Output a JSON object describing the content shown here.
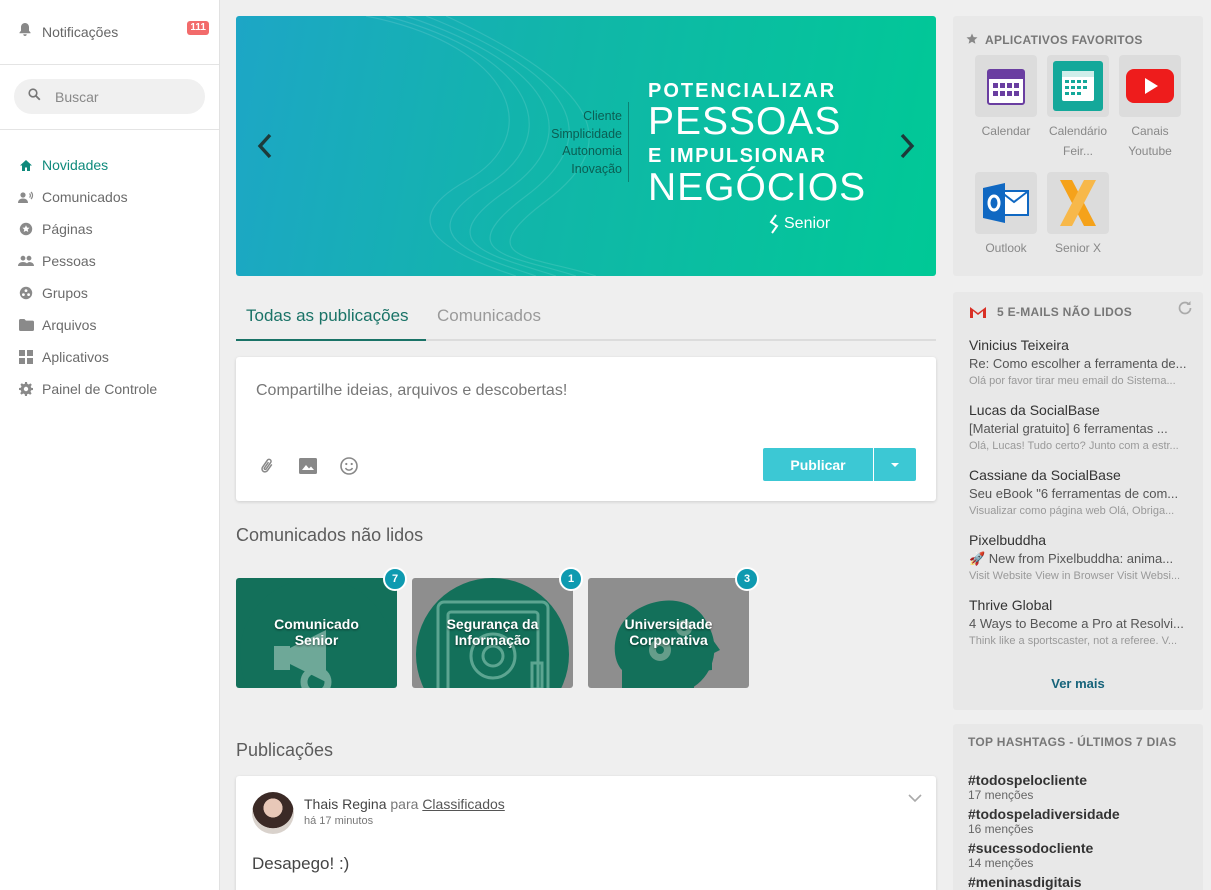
{
  "sidebar": {
    "notifications_label": "Notificações",
    "notifications_count": "111",
    "search_placeholder": "Buscar",
    "nav": [
      {
        "label": "Novidades",
        "icon": "home-icon",
        "active": true
      },
      {
        "label": "Comunicados",
        "icon": "megaphone-icon"
      },
      {
        "label": "Páginas",
        "icon": "page-star-icon"
      },
      {
        "label": "Pessoas",
        "icon": "people-icon"
      },
      {
        "label": "Grupos",
        "icon": "groups-icon"
      },
      {
        "label": "Arquivos",
        "icon": "folder-icon"
      },
      {
        "label": "Aplicativos",
        "icon": "apps-icon"
      },
      {
        "label": "Painel de Controle",
        "icon": "gear-icon"
      }
    ]
  },
  "banner": {
    "words": [
      "Cliente",
      "Simplicidade",
      "Autonomia",
      "Inovação"
    ],
    "line1": "POTENCIALIZAR",
    "line2": "PESSOAS",
    "line3": "E IMPULSIONAR",
    "line4": "NEGÓCIOS",
    "brand": "Senior",
    "accent": "#00c996"
  },
  "tabs": [
    {
      "label": "Todas as publicações",
      "active": true
    },
    {
      "label": "Comunicados",
      "active": false
    }
  ],
  "composer": {
    "placeholder": "Compartilhe ideias, arquivos e descobertas!",
    "publish_label": "Publicar"
  },
  "unread": {
    "title": "Comunicados não lidos",
    "cards": [
      {
        "title_line1": "Comunicado",
        "title_line2": "Senior",
        "count": "7",
        "color": "#13705a"
      },
      {
        "title_line1": "Segurança da",
        "title_line2": "Informação",
        "count": "1",
        "color": "#13705a"
      },
      {
        "title_line1": "Universidade",
        "title_line2": "Corporativa",
        "count": "3",
        "color": "#13705a"
      }
    ]
  },
  "posts": {
    "title": "Publicações",
    "items": [
      {
        "author": "Thais Regina",
        "connector": "para",
        "group": "Classificados",
        "time": "há 17 minutos",
        "body": "Desapego! :)"
      }
    ]
  },
  "apps": {
    "title": "APLICATIVOS FAVORITOS",
    "items": [
      {
        "name_line1": "Calendar",
        "name_line2": "",
        "icon": "calendar-icon"
      },
      {
        "name_line1": "Calendário",
        "name_line2": "Feir...",
        "icon": "calendar-green-icon"
      },
      {
        "name_line1": "Canais",
        "name_line2": "Youtube",
        "icon": "youtube-icon"
      },
      {
        "name_line1": "Outlook",
        "name_line2": "",
        "icon": "outlook-icon"
      },
      {
        "name_line1": "Senior X",
        "name_line2": "",
        "icon": "senior-x-icon"
      }
    ]
  },
  "emails": {
    "title": "5 E-MAILS NÃO LIDOS",
    "items": [
      {
        "from": "Vinicius Teixeira",
        "subject": "Re: Como escolher a ferramenta de...",
        "preview": "Olá por favor tirar meu email do Sistema..."
      },
      {
        "from": "Lucas da SocialBase",
        "subject": "[Material gratuito] 6 ferramentas ...",
        "preview": "Olá, Lucas! Tudo certo? Junto com a estr..."
      },
      {
        "from": "Cassiane da SocialBase",
        "subject": "Seu eBook \"6 ferramentas de com...",
        "preview": "Visualizar como página web Olá, Obriga..."
      },
      {
        "from": "Pixelbuddha",
        "subject": "🚀 New from Pixelbuddha: anima...",
        "preview": "Visit Website View in Browser Visit Websi..."
      },
      {
        "from": "Thrive Global",
        "subject": "4 Ways to Become a Pro at Resolvi...",
        "preview": "Think like a sportscaster, not a referee. V..."
      }
    ],
    "more_label": "Ver mais"
  },
  "hashtags": {
    "title": "TOP HASHTAGS - ÚLTIMOS 7 DIAS",
    "items": [
      {
        "tag": "#todospelocliente",
        "mentions": "17 menções"
      },
      {
        "tag": "#todospeladiversidade",
        "mentions": "16 menções"
      },
      {
        "tag": "#sucessodocliente",
        "mentions": "14 menções"
      },
      {
        "tag": "#meninasdigitais",
        "mentions": ""
      }
    ]
  }
}
